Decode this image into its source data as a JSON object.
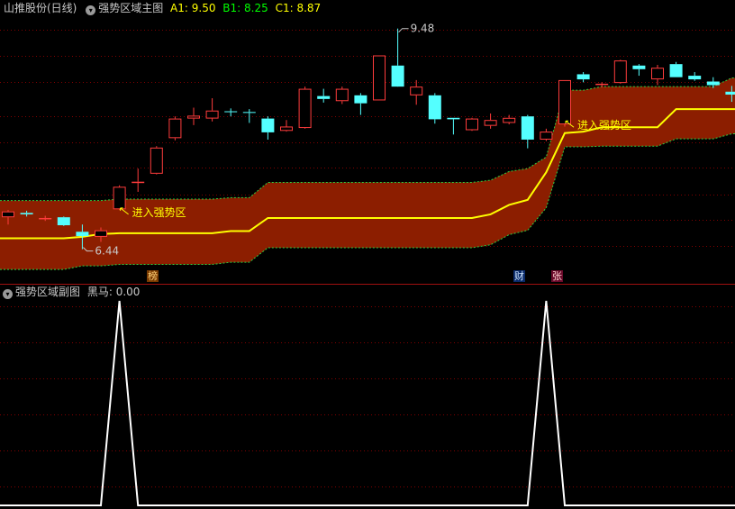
{
  "main_header": {
    "stock_title": "山推股份(日线)",
    "indicator_name": "强势区域主图",
    "a1_label": "A1: 9.50",
    "b1_label": "B1: 8.25",
    "c1_label": "C1: 8.87"
  },
  "sub_header": {
    "indicator_name": "强势区域副图",
    "value_label": "黑马: 0.00"
  },
  "markers": {
    "bang": "榜",
    "cai": "财",
    "zhang": "张"
  },
  "colors": {
    "up": "#ff3c3c",
    "down": "#54ffff",
    "band": "#8c1e00",
    "midline": "#ffff00",
    "annotation": "#ffff00",
    "signal": "#ffffff",
    "grid": "#800000",
    "a1": "#ffff00",
    "b1": "#00ff00",
    "c1": "#ffff00"
  },
  "chart_data": [
    {
      "type": "candlestick",
      "title": "强势区域主图",
      "ylim": [
        6.1,
        9.65
      ],
      "candles": [
        {
          "o": 6.88,
          "h": 6.98,
          "l": 6.78,
          "c": 6.96
        },
        {
          "o": 6.94,
          "h": 6.97,
          "l": 6.89,
          "c": 6.92
        },
        {
          "o": 6.86,
          "h": 6.9,
          "l": 6.83,
          "c": 6.87
        },
        {
          "o": 6.88,
          "h": 6.89,
          "l": 6.76,
          "c": 6.77
        },
        {
          "o": 6.68,
          "h": 6.78,
          "l": 6.44,
          "c": 6.62
        },
        {
          "o": 6.61,
          "h": 6.74,
          "l": 6.54,
          "c": 6.7
        },
        {
          "o": 6.99,
          "h": 7.32,
          "l": 6.98,
          "c": 7.3
        },
        {
          "o": 7.37,
          "h": 7.55,
          "l": 7.23,
          "c": 7.37
        },
        {
          "o": 7.48,
          "h": 7.86,
          "l": 7.47,
          "c": 7.84
        },
        {
          "o": 7.97,
          "h": 8.27,
          "l": 7.94,
          "c": 8.24
        },
        {
          "o": 8.24,
          "h": 8.39,
          "l": 8.15,
          "c": 8.28
        },
        {
          "o": 8.24,
          "h": 8.52,
          "l": 8.2,
          "c": 8.35
        },
        {
          "o": 8.34,
          "h": 8.38,
          "l": 8.27,
          "c": 8.33
        },
        {
          "o": 8.33,
          "h": 8.37,
          "l": 8.18,
          "c": 8.32
        },
        {
          "o": 8.24,
          "h": 8.27,
          "l": 7.95,
          "c": 8.05
        },
        {
          "o": 8.07,
          "h": 8.22,
          "l": 8.06,
          "c": 8.13
        },
        {
          "o": 8.11,
          "h": 8.68,
          "l": 8.1,
          "c": 8.65
        },
        {
          "o": 8.55,
          "h": 8.65,
          "l": 8.46,
          "c": 8.51
        },
        {
          "o": 8.48,
          "h": 8.68,
          "l": 8.44,
          "c": 8.65
        },
        {
          "o": 8.56,
          "h": 8.59,
          "l": 8.29,
          "c": 8.45
        },
        {
          "o": 8.49,
          "h": 9.11,
          "l": 8.49,
          "c": 9.11
        },
        {
          "o": 8.97,
          "h": 9.48,
          "l": 8.75,
          "c": 8.68
        },
        {
          "o": 8.56,
          "h": 8.77,
          "l": 8.43,
          "c": 8.68
        },
        {
          "o": 8.56,
          "h": 8.59,
          "l": 8.17,
          "c": 8.23
        },
        {
          "o": 8.25,
          "h": 8.25,
          "l": 8.02,
          "c": 8.23
        },
        {
          "o": 8.08,
          "h": 8.25,
          "l": 8.07,
          "c": 8.24
        },
        {
          "o": 8.14,
          "h": 8.31,
          "l": 8.1,
          "c": 8.22
        },
        {
          "o": 8.18,
          "h": 8.29,
          "l": 8.16,
          "c": 8.25
        },
        {
          "o": 8.27,
          "h": 8.29,
          "l": 7.83,
          "c": 7.95
        },
        {
          "o": 7.95,
          "h": 8.1,
          "l": 7.93,
          "c": 8.06
        },
        {
          "o": 8.16,
          "h": 8.77,
          "l": 8.13,
          "c": 8.77
        },
        {
          "o": 8.85,
          "h": 8.88,
          "l": 8.74,
          "c": 8.78
        },
        {
          "o": 8.71,
          "h": 8.74,
          "l": 8.67,
          "c": 8.72
        },
        {
          "o": 8.73,
          "h": 9.05,
          "l": 8.72,
          "c": 9.04
        },
        {
          "o": 8.97,
          "h": 8.99,
          "l": 8.83,
          "c": 8.92
        },
        {
          "o": 8.78,
          "h": 8.98,
          "l": 8.7,
          "c": 8.94
        },
        {
          "o": 8.99,
          "h": 9.02,
          "l": 8.81,
          "c": 8.81
        },
        {
          "o": 8.83,
          "h": 8.88,
          "l": 8.76,
          "c": 8.78
        },
        {
          "o": 8.75,
          "h": 8.81,
          "l": 8.66,
          "c": 8.7
        },
        {
          "o": 8.61,
          "h": 8.69,
          "l": 8.47,
          "c": 8.57
        }
      ],
      "band": {
        "upper": [
          7.11,
          7.11,
          7.11,
          7.11,
          7.11,
          7.11,
          7.13,
          7.13,
          7.13,
          7.13,
          7.13,
          7.13,
          7.15,
          7.15,
          7.36,
          7.36,
          7.36,
          7.36,
          7.36,
          7.36,
          7.36,
          7.36,
          7.36,
          7.36,
          7.36,
          7.36,
          7.39,
          7.51,
          7.55,
          7.71,
          8.63,
          8.63,
          8.68,
          8.68,
          8.68,
          8.68,
          8.68,
          8.68,
          8.68,
          8.8
        ],
        "mid": [
          6.59,
          6.59,
          6.59,
          6.59,
          6.61,
          6.65,
          6.66,
          6.66,
          6.66,
          6.66,
          6.66,
          6.66,
          6.69,
          6.69,
          6.87,
          6.87,
          6.87,
          6.87,
          6.87,
          6.87,
          6.87,
          6.87,
          6.87,
          6.87,
          6.87,
          6.87,
          6.92,
          7.05,
          7.12,
          7.5,
          8.04,
          8.06,
          8.12,
          8.12,
          8.12,
          8.12,
          8.37,
          8.37,
          8.37,
          8.37
        ],
        "lower": [
          6.16,
          6.16,
          6.16,
          6.16,
          6.21,
          6.21,
          6.23,
          6.23,
          6.23,
          6.23,
          6.23,
          6.23,
          6.26,
          6.26,
          6.46,
          6.46,
          6.46,
          6.46,
          6.46,
          6.46,
          6.46,
          6.46,
          6.46,
          6.46,
          6.46,
          6.46,
          6.5,
          6.64,
          6.7,
          7.01,
          7.85,
          7.85,
          7.86,
          7.86,
          7.86,
          7.86,
          7.96,
          7.96,
          7.96,
          8.03
        ]
      },
      "annotations": [
        {
          "text": "9.48",
          "index": 21,
          "value": 9.48
        },
        {
          "text": "6.44",
          "index": 4,
          "value": 6.44
        },
        {
          "text": "进入强势区",
          "index": 6,
          "value": 6.97
        },
        {
          "text": "进入强势区",
          "index": 30,
          "value": 8.17
        }
      ],
      "values": {
        "A1": 9.5,
        "B1": 8.25,
        "C1": 8.87
      },
      "markers": [
        {
          "text": "榜",
          "index": 8
        },
        {
          "text": "财",
          "index": 27
        },
        {
          "text": "张",
          "index": 29
        }
      ]
    },
    {
      "type": "line",
      "title": "强势区域副图",
      "series": [
        {
          "name": "黑马",
          "values": [
            0,
            0,
            0,
            0,
            0,
            0,
            1,
            0,
            0,
            0,
            0,
            0,
            0,
            0,
            0,
            0,
            0,
            0,
            0,
            0,
            0,
            0,
            0,
            0,
            0,
            0,
            0,
            0,
            0,
            1,
            0,
            0,
            0,
            0,
            0,
            0,
            0,
            0,
            0,
            0
          ]
        }
      ],
      "ylim": [
        0,
        1
      ]
    }
  ]
}
